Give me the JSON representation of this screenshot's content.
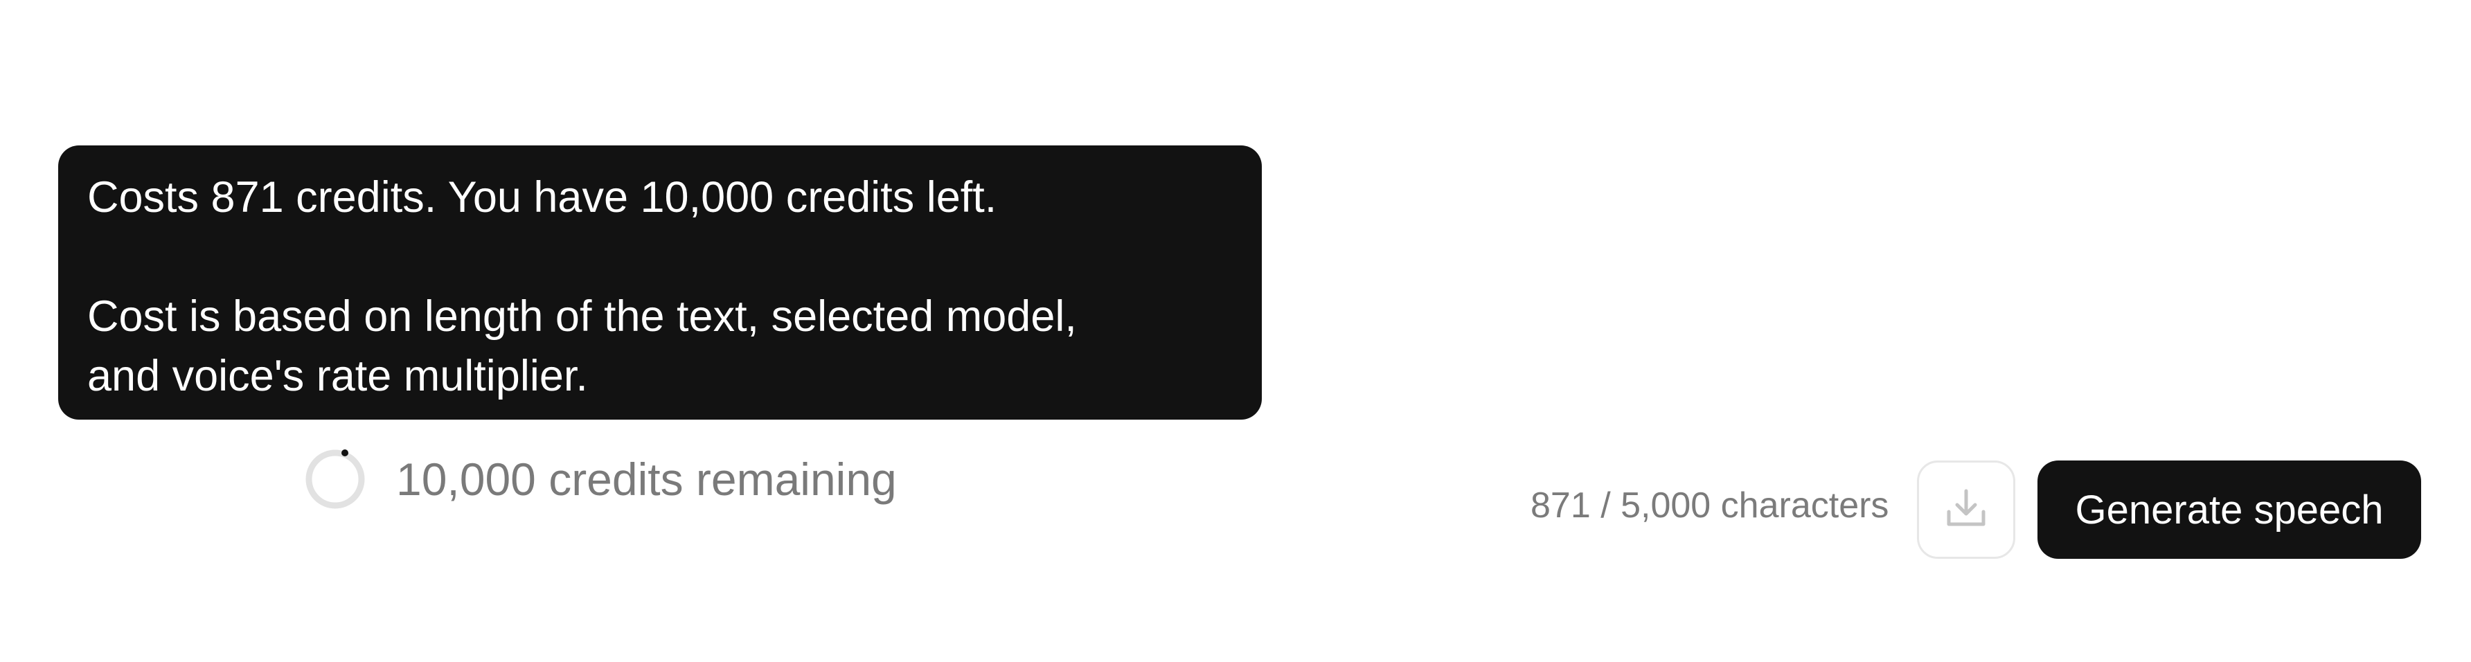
{
  "tooltip": {
    "line1": "Costs 871 credits. You have 10,000 credits left.",
    "line2": "Cost is based on length of the text, selected model,",
    "line3": "and voice's rate multiplier."
  },
  "credits": {
    "remaining_text": "10,000 credits remaining",
    "remaining_fraction": 1.0
  },
  "editor": {
    "char_count": "871 / 5,000 characters"
  },
  "actions": {
    "download_icon": "download-icon",
    "generate_label": "Generate speech"
  },
  "colors": {
    "dark": "#121212",
    "muted_text": "#7a7a7a",
    "border": "#e7e7e7"
  }
}
